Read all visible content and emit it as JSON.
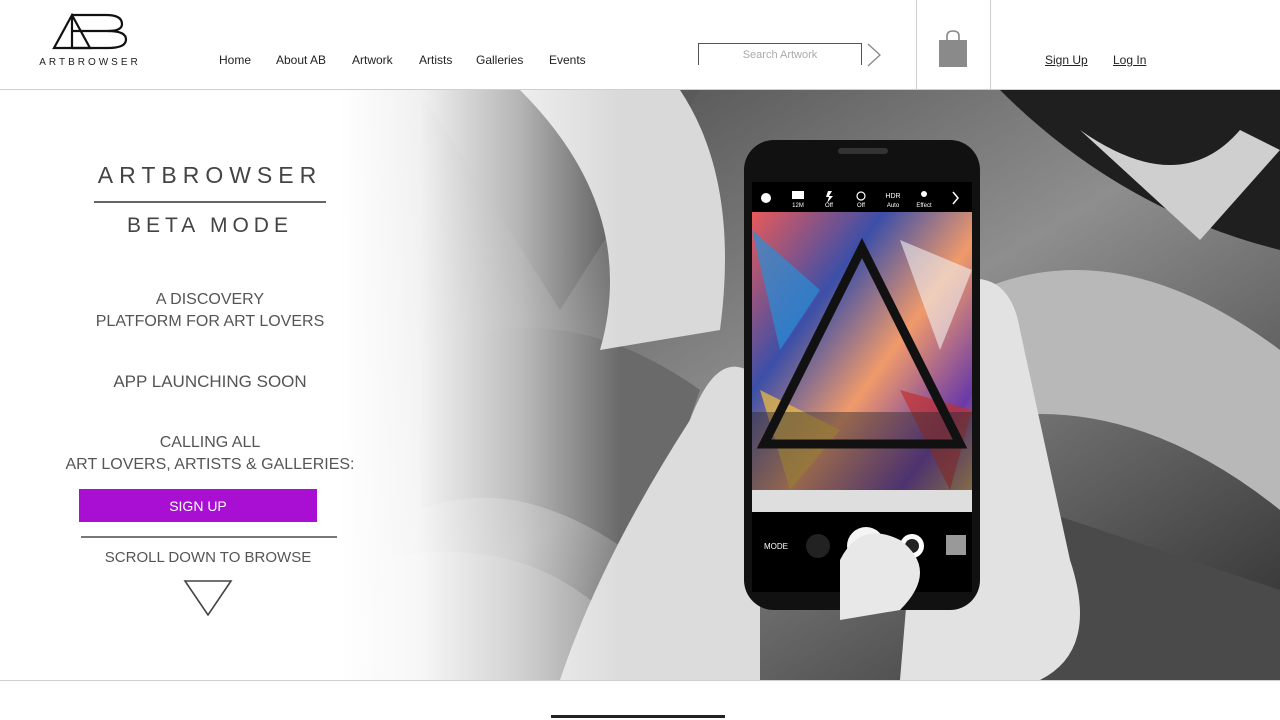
{
  "logo": {
    "monogram": "AB",
    "text": "ARTBROWSER"
  },
  "nav": {
    "items": [
      {
        "label": "Home"
      },
      {
        "label": "About AB"
      },
      {
        "label": "Artwork"
      },
      {
        "label": "Artists"
      },
      {
        "label": "Galleries"
      },
      {
        "label": "Events"
      }
    ]
  },
  "search": {
    "placeholder": "Search Artwork",
    "submit_icon": "chevron-right-icon"
  },
  "cart": {
    "icon": "shopping-bag-icon"
  },
  "auth": {
    "signup_label": "Sign Up",
    "login_label": "Log In"
  },
  "hero": {
    "title": "ARTBROWSER",
    "subtitle": "BETA MODE",
    "tagline_line1": "A DISCOVERY",
    "tagline_line2": "PLATFORM FOR ART LOVERS",
    "launch_text": "APP LAUNCHING SOON",
    "calling_line1": "CALLING ALL",
    "calling_line2": "ART LOVERS, ARTISTS & GALLERIES:",
    "signup_button": "SIGN UP",
    "scroll_text": "SCROLL DOWN TO BROWSE",
    "scroll_icon": "triangle-down-icon"
  },
  "phone_ui": {
    "top_icons": [
      {
        "icon": "gear-icon",
        "label": ""
      },
      {
        "icon": "resolution-icon",
        "label": "12M"
      },
      {
        "icon": "flash-off-icon",
        "label": "Off"
      },
      {
        "icon": "timer-icon",
        "label": "Off"
      },
      {
        "icon": "hdr-icon",
        "label": "Auto",
        "top": "HDR"
      },
      {
        "icon": "effect-icon",
        "label": "Effect"
      }
    ],
    "mode_label": "MODE"
  },
  "colors": {
    "accent": "#a80fd3",
    "text": "#444444",
    "divider": "#cfcfcf"
  }
}
